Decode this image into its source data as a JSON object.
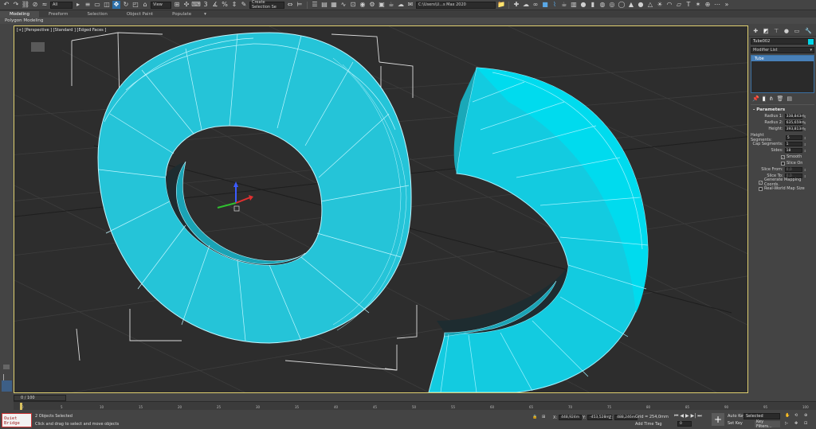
{
  "toolbar": {
    "selection_set": "All",
    "ref_coord": "View",
    "named_selection": "Create Selection Se",
    "workspace": "C:\\Users\\U...s Max 2020"
  },
  "ribbon": {
    "tabs": [
      "Modeling",
      "Freeform",
      "Selection",
      "Object Paint",
      "Populate"
    ],
    "sub_label": "Polygon Modeling"
  },
  "viewport": {
    "label": "[+] [Perspective ] [Standard ] [Edged Faces ]",
    "object_color": "#00d6e8"
  },
  "command_panel": {
    "object_name": "Tube002",
    "modifier_list": "Modifier List",
    "stack_item": "Tube",
    "rollout_title": "Parameters",
    "params": [
      {
        "label": "Radius 1:",
        "value": "338,843m"
      },
      {
        "label": "Radius 2:",
        "value": "635,659m"
      },
      {
        "label": "Height:",
        "value": "393,813m"
      },
      {
        "label": "Height Segments:",
        "value": "5"
      },
      {
        "label": "Cap Segments:",
        "value": "1"
      },
      {
        "label": "Sides:",
        "value": "18"
      }
    ],
    "smooth_label": "Smooth",
    "slice_on_label": "Slice On",
    "slice_from": {
      "label": "Slice From:",
      "value": "0,0"
    },
    "slice_to": {
      "label": "Slice To:",
      "value": "0,0"
    },
    "gen_mapping": "Generate Mapping Coords.",
    "real_world": "Real-World Map Size"
  },
  "timeline": {
    "frame_display": "0 / 100",
    "ticks": [
      "0",
      "5",
      "10",
      "15",
      "20",
      "25",
      "30",
      "35",
      "40",
      "45",
      "50",
      "55",
      "60",
      "65",
      "70",
      "75",
      "80",
      "85",
      "90",
      "95",
      "100"
    ],
    "current_frame": 0
  },
  "status": {
    "maxscript": "Ouiet Bridge",
    "selection": "2 Objects Selected",
    "prompt": "Click and drag to select and move objects",
    "x_label": "X:",
    "x_value": "448,924m",
    "y_label": "Y:",
    "y_value": "-453,528m",
    "z_label": "Z:",
    "z_value": "488,246m",
    "grid": "Grid = 254,0mm",
    "add_time_tag": "Add Time Tag",
    "frame": "0",
    "auto_key": "Auto Key",
    "set_key": "Set Key",
    "selected": "Selected",
    "key_filters": "Key Filters..."
  }
}
